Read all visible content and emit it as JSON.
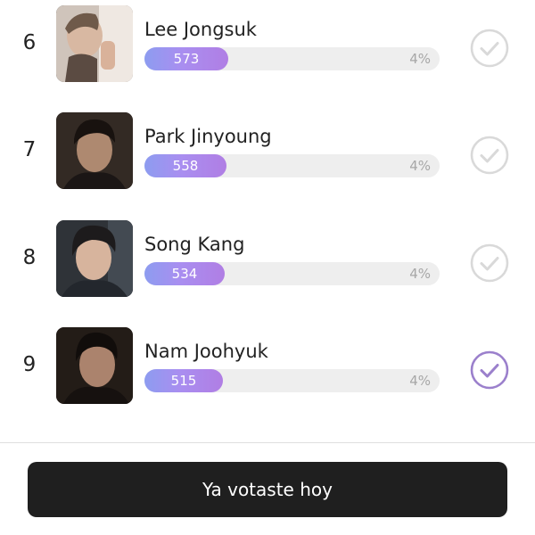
{
  "ranking": {
    "items": [
      {
        "rank": "6",
        "name": "Lee Jongsuk",
        "votes": "573",
        "percent": "4%",
        "share": 0.29,
        "selected": false
      },
      {
        "rank": "7",
        "name": "Park Jinyoung",
        "votes": "558",
        "percent": "4%",
        "share": 0.28,
        "selected": false
      },
      {
        "rank": "8",
        "name": "Song Kang",
        "votes": "534",
        "percent": "4%",
        "share": 0.27,
        "selected": false
      },
      {
        "rank": "9",
        "name": "Nam Joohyuk",
        "votes": "515",
        "percent": "4%",
        "share": 0.27,
        "selected": true
      }
    ]
  },
  "footer": {
    "button_label": "Ya votaste hoy"
  },
  "colors": {
    "accent": "#9b7fd8",
    "check_inactive": "#d9d9d9",
    "check_active": "#9b80cc",
    "button_bg": "#1f1f1f",
    "track": "#eeeeee"
  },
  "icons": {
    "vote": "check-circle-icon",
    "thumbnail": "profile-photo"
  }
}
